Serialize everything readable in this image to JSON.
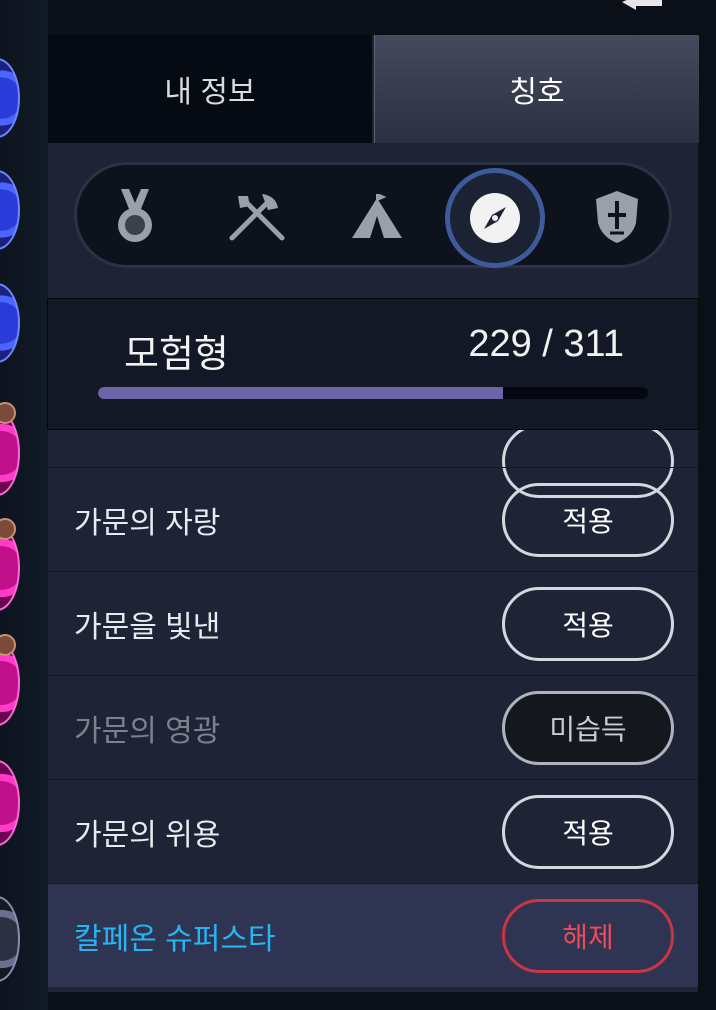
{
  "tabs": [
    {
      "label": "내 정보",
      "selected": false
    },
    {
      "label": "칭호",
      "selected": true
    }
  ],
  "categories": [
    {
      "icon": "medal-icon",
      "selected": false
    },
    {
      "icon": "crossed-weapons-icon",
      "selected": false
    },
    {
      "icon": "tent-icon",
      "selected": false
    },
    {
      "icon": "compass-icon",
      "selected": true
    },
    {
      "icon": "shield-icon",
      "selected": false
    }
  ],
  "progress": {
    "category_name": "모험형",
    "count_text": "229 / 311",
    "current": 229,
    "total": 311
  },
  "titles": [
    {
      "name": "가문의 자랑",
      "button": "적용",
      "state": "apply"
    },
    {
      "name": "가문을 빛낸",
      "button": "적용",
      "state": "apply"
    },
    {
      "name": "가문의 영광",
      "button": "미습득",
      "state": "locked"
    },
    {
      "name": "가문의 위용",
      "button": "적용",
      "state": "apply"
    },
    {
      "name": "칼페온 슈퍼스타",
      "button": "해제",
      "state": "equipped"
    }
  ],
  "colors": {
    "accent_blue": "#27b4f2",
    "release_red": "#ee4a5a",
    "progress_fill": "#6c65a8"
  }
}
